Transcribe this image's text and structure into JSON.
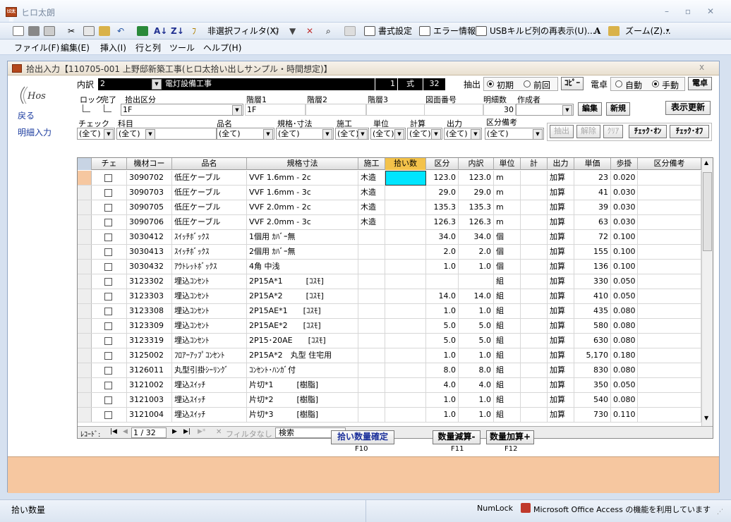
{
  "app": {
    "icon_text": "ﾋﾛ太朗",
    "title": "ヒロ太朗"
  },
  "toolbar": {
    "filter_exclude": "非選択フィルタ(X)",
    "format": "書式設定",
    "error_info": "エラー情報",
    "usb": "USBキルビ",
    "redisplay": "列の再表示(U)...",
    "zoom": "ズーム(Z)..."
  },
  "menu": [
    "ファイル(F)",
    "編集(E)",
    "挿入(I)",
    "行と列",
    "ツール",
    "ヘルプ(H)"
  ],
  "window": {
    "title": "拾出入力【110705-001 上野邸新築工事(ヒロ太拾い出しサンプル・時間想定)】",
    "close": "x"
  },
  "logo": "Hos",
  "nav": {
    "back": "戻る",
    "detail": "明細入力"
  },
  "header": {
    "breakdown_label": "内訳",
    "breakdown_value": "2",
    "breakdown_name": "電灯設備工事",
    "qty": "1",
    "unit": "式",
    "count": "32",
    "extract_label": "抽出",
    "opt_initial": "初期",
    "opt_previous": "前回",
    "copy_btn": "ｺﾋﾟｰ",
    "calc_label": "電卓",
    "opt_auto": "自動",
    "opt_manual": "手動",
    "calc_btn": "電卓"
  },
  "row2": {
    "lock": "ロック",
    "done": "完了",
    "category_label": "拾出区分",
    "category_value": "1F",
    "tier1": "階層1",
    "tier1_value": "1F",
    "tier2": "階層2",
    "tier3": "階層3",
    "drawing": "図面番号",
    "detail_count_label": "明細数",
    "detail_count": "30",
    "author": "作成者",
    "edit_btn": "編集",
    "new_btn": "新規",
    "refresh_btn": "表示更新"
  },
  "filters": {
    "check": "チェック",
    "subject": "科目",
    "item": "品名",
    "spec": "規格･寸法",
    "construction": "施工",
    "unit": "単位",
    "calc": "計算",
    "output": "出力",
    "note": "区分備考",
    "all": "(全て)",
    "extract_btn": "抽出",
    "cancel_btn": "解除",
    "clear_btn": "ｸﾘｱ",
    "check_on": "ﾁｪｯｸ･ｵﾝ",
    "check_off": "ﾁｪｯｸ･ｵﾌ"
  },
  "columns": [
    "チェ",
    "機材コー",
    "品名",
    "規格寸法",
    "施工",
    "拾い数",
    "区分",
    "内訳",
    "単位",
    "計",
    "出力",
    "単価",
    "歩掛",
    "区分備考"
  ],
  "rows": [
    {
      "code": "3090702",
      "name": "低圧ケーブル",
      "spec": "VVF 1.6mm - 2c",
      "const": "木造",
      "pick": "",
      "qty": "123.0",
      "br": "123.0",
      "unit": "m",
      "calc": "",
      "out": "加算",
      "price": "23",
      "rate": "0.020"
    },
    {
      "code": "3090703",
      "name": "低圧ケーブル",
      "spec": "VVF 1.6mm - 3c",
      "const": "木造",
      "pick": "",
      "qty": "29.0",
      "br": "29.0",
      "unit": "m",
      "calc": "",
      "out": "加算",
      "price": "41",
      "rate": "0.030"
    },
    {
      "code": "3090705",
      "name": "低圧ケーブル",
      "spec": "VVF 2.0mm - 2c",
      "const": "木造",
      "pick": "",
      "qty": "135.3",
      "br": "135.3",
      "unit": "m",
      "calc": "",
      "out": "加算",
      "price": "39",
      "rate": "0.030"
    },
    {
      "code": "3090706",
      "name": "低圧ケーブル",
      "spec": "VVF 2.0mm - 3c",
      "const": "木造",
      "pick": "",
      "qty": "126.3",
      "br": "126.3",
      "unit": "m",
      "calc": "",
      "out": "加算",
      "price": "63",
      "rate": "0.030"
    },
    {
      "code": "3030412",
      "name": "ｽｲｯﾁﾎﾞｯｸｽ",
      "spec": "1個用 ｶﾊﾞｰ無",
      "const": "",
      "pick": "",
      "qty": "34.0",
      "br": "34.0",
      "unit": "個",
      "calc": "",
      "out": "加算",
      "price": "72",
      "rate": "0.100"
    },
    {
      "code": "3030413",
      "name": "ｽｲｯﾁﾎﾞｯｸｽ",
      "spec": "2個用 ｶﾊﾞｰ無",
      "const": "",
      "pick": "",
      "qty": "2.0",
      "br": "2.0",
      "unit": "個",
      "calc": "",
      "out": "加算",
      "price": "155",
      "rate": "0.100"
    },
    {
      "code": "3030432",
      "name": "ｱｳﾄﾚｯﾄﾎﾞｯｸｽ",
      "spec": "4角 中浅",
      "const": "",
      "pick": "",
      "qty": "1.0",
      "br": "1.0",
      "unit": "個",
      "calc": "",
      "out": "加算",
      "price": "136",
      "rate": "0.100"
    },
    {
      "code": "3123302",
      "name": "埋込ｺﾝｾﾝﾄ",
      "spec": "2P15A*1　　　[ｺｽﾓ]",
      "const": "",
      "pick": "",
      "qty": "",
      "br": "",
      "unit": "組",
      "calc": "",
      "out": "加算",
      "price": "330",
      "rate": "0.050"
    },
    {
      "code": "3123303",
      "name": "埋込ｺﾝｾﾝﾄ",
      "spec": "2P15A*2　　　[ｺｽﾓ]",
      "const": "",
      "pick": "",
      "qty": "14.0",
      "br": "14.0",
      "unit": "組",
      "calc": "",
      "out": "加算",
      "price": "410",
      "rate": "0.050"
    },
    {
      "code": "3123308",
      "name": "埋込ｺﾝｾﾝﾄ",
      "spec": "2P15AE*1　　[ｺｽﾓ]",
      "const": "",
      "pick": "",
      "qty": "1.0",
      "br": "1.0",
      "unit": "組",
      "calc": "",
      "out": "加算",
      "price": "435",
      "rate": "0.080"
    },
    {
      "code": "3123309",
      "name": "埋込ｺﾝｾﾝﾄ",
      "spec": "2P15AE*2　　[ｺｽﾓ]",
      "const": "",
      "pick": "",
      "qty": "5.0",
      "br": "5.0",
      "unit": "組",
      "calc": "",
      "out": "加算",
      "price": "580",
      "rate": "0.080"
    },
    {
      "code": "3123319",
      "name": "埋込ｺﾝｾﾝﾄ",
      "spec": "2P15･20AE　　[ｺｽﾓ]",
      "const": "",
      "pick": "",
      "qty": "5.0",
      "br": "5.0",
      "unit": "組",
      "calc": "",
      "out": "加算",
      "price": "630",
      "rate": "0.080"
    },
    {
      "code": "3125002",
      "name": "ﾌﾛｱｰｱｯﾌﾟｺﾝｾﾝﾄ",
      "spec": "2P15A*2　丸型 住宅用",
      "const": "",
      "pick": "",
      "qty": "1.0",
      "br": "1.0",
      "unit": "組",
      "calc": "",
      "out": "加算",
      "price": "5,170",
      "rate": "0.180"
    },
    {
      "code": "3126011",
      "name": "丸型引掛ｼｰﾘﾝｸﾞ",
      "spec": "ｺﾝｾﾝﾄ･ﾊﾝｶﾞ付",
      "const": "",
      "pick": "",
      "qty": "8.0",
      "br": "8.0",
      "unit": "組",
      "calc": "",
      "out": "加算",
      "price": "830",
      "rate": "0.080"
    },
    {
      "code": "3121002",
      "name": "埋込ｽｲｯﾁ",
      "spec": "片切*1　　　[樹脂]",
      "const": "",
      "pick": "",
      "qty": "4.0",
      "br": "4.0",
      "unit": "組",
      "calc": "",
      "out": "加算",
      "price": "350",
      "rate": "0.050"
    },
    {
      "code": "3121003",
      "name": "埋込ｽｲｯﾁ",
      "spec": "片切*2　　　[樹脂]",
      "const": "",
      "pick": "",
      "qty": "1.0",
      "br": "1.0",
      "unit": "組",
      "calc": "",
      "out": "加算",
      "price": "540",
      "rate": "0.080"
    },
    {
      "code": "3121004",
      "name": "埋込ｽｲｯﾁ",
      "spec": "片切*3　　　[樹脂]",
      "const": "",
      "pick": "",
      "qty": "1.0",
      "br": "1.0",
      "unit": "組",
      "calc": "",
      "out": "加算",
      "price": "730",
      "rate": "0.110"
    }
  ],
  "recnav": {
    "label": "ﾚｺｰﾄﾞ:",
    "position": "1 / 32",
    "nofilter": "フィルタなし",
    "search": "検索"
  },
  "actions": {
    "confirm": "拾い数量確定",
    "confirm_key": "F10",
    "dec": "数量減算-",
    "dec_key": "F11",
    "inc": "数量加算+",
    "inc_key": "F12"
  },
  "status": {
    "text": "拾い数量",
    "numlock": "NumLock",
    "access": "Microsoft Office Access の機能を利用しています"
  },
  "colors": {
    "accent": "#f6c7a0",
    "highlight": "#00e5ff"
  }
}
